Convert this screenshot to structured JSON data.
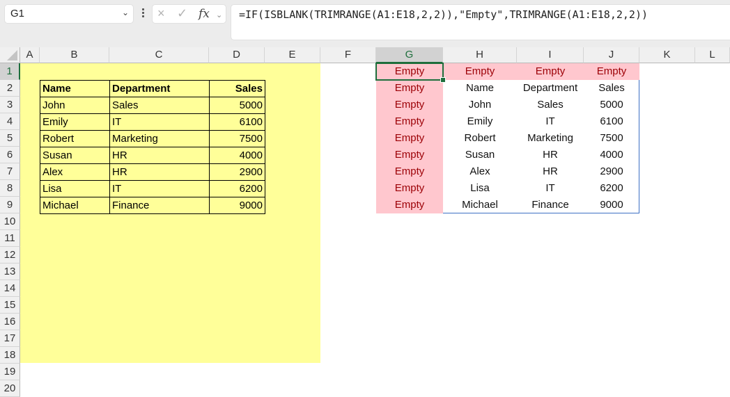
{
  "toolbar": {
    "name_box": "G1",
    "cancel_icon": "×",
    "enter_icon": "✓",
    "fx_label": "fx",
    "formula": "=IF(ISBLANK(TRIMRANGE(A1:E18,2,2)),\"Empty\",TRIMRANGE(A1:E18,2,2))"
  },
  "columns": [
    "A",
    "B",
    "C",
    "D",
    "E",
    "F",
    "G",
    "H",
    "I",
    "J",
    "K",
    "L"
  ],
  "selected_column": "G",
  "rows": [
    "1",
    "2",
    "3",
    "4",
    "5",
    "6",
    "7",
    "8",
    "9",
    "10",
    "11",
    "12",
    "13",
    "14",
    "15",
    "16",
    "17",
    "18",
    "19",
    "20"
  ],
  "selected_row": "1",
  "source_table": {
    "headers": [
      "Name",
      "Department",
      "Sales"
    ],
    "rows": [
      [
        "John",
        "Sales",
        "5000"
      ],
      [
        "Emily",
        "IT",
        "6100"
      ],
      [
        "Robert",
        "Marketing",
        "7500"
      ],
      [
        "Susan",
        "HR",
        "4000"
      ],
      [
        "Alex",
        "HR",
        "2900"
      ],
      [
        "Lisa",
        "IT",
        "6200"
      ],
      [
        "Michael",
        "Finance",
        "9000"
      ]
    ]
  },
  "spill_result": {
    "empty_label": "Empty",
    "rows": [
      [
        "Empty",
        "Empty",
        "Empty",
        "Empty"
      ],
      [
        "Empty",
        "Name",
        "Department",
        "Sales"
      ],
      [
        "Empty",
        "John",
        "Sales",
        "5000"
      ],
      [
        "Empty",
        "Emily",
        "IT",
        "6100"
      ],
      [
        "Empty",
        "Robert",
        "Marketing",
        "7500"
      ],
      [
        "Empty",
        "Susan",
        "HR",
        "4000"
      ],
      [
        "Empty",
        "Alex",
        "HR",
        "2900"
      ],
      [
        "Empty",
        "Lisa",
        "IT",
        "6200"
      ],
      [
        "Empty",
        "Michael",
        "Finance",
        "9000"
      ]
    ]
  },
  "colors": {
    "highlight_fill": "#ffff99",
    "empty_fill": "#ffc7ce",
    "empty_text": "#9c0006",
    "selection": "#1e6e3c",
    "spill_border": "#3b6fc4"
  }
}
